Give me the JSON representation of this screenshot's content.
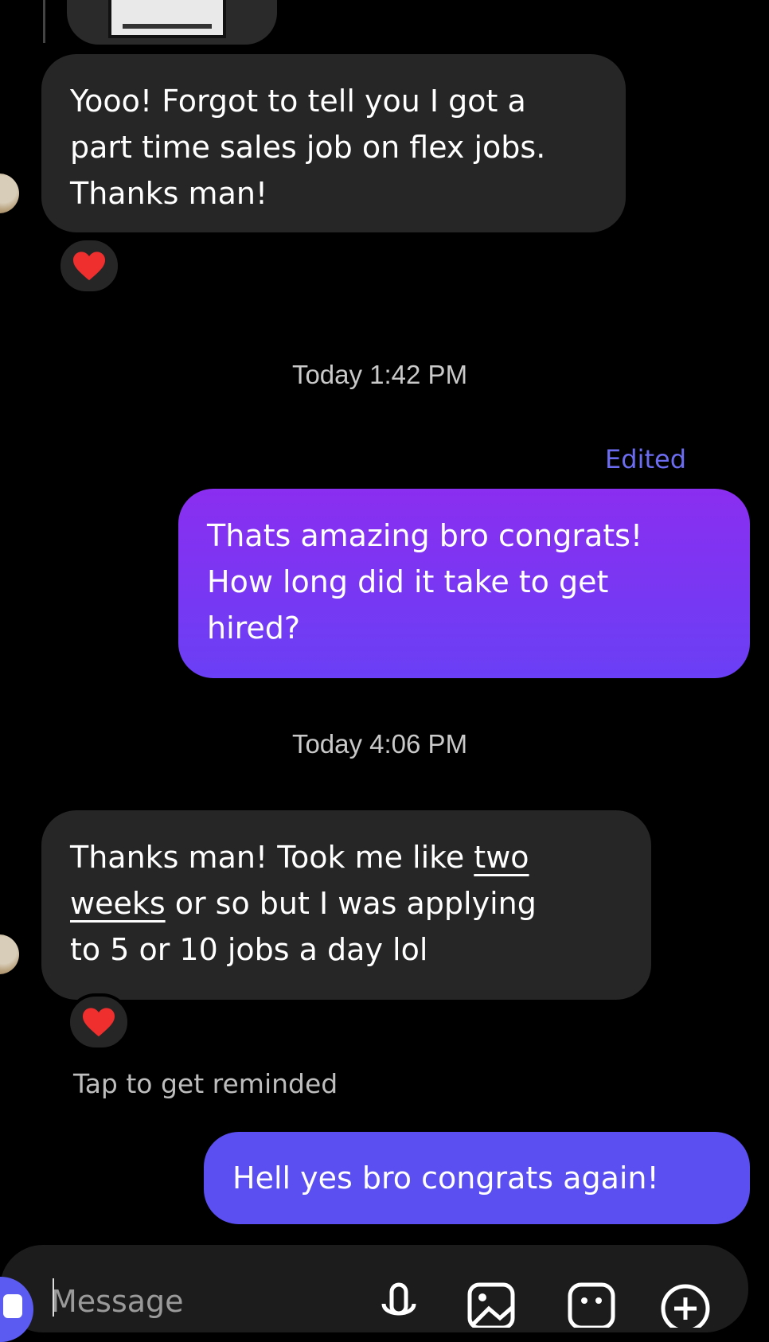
{
  "thread": {
    "messages": [
      {
        "direction": "incoming",
        "text": "Yooo! Forgot to tell you I got a part time sales job on flex jobs. Thanks man!",
        "lines": [
          "Yooo! Forgot to tell you I got a",
          "part time sales job on flex jobs.",
          "Thanks man!"
        ],
        "reaction": "❤️"
      },
      {
        "timestamp": "Today 1:42 PM"
      },
      {
        "direction": "outgoing",
        "status": "Edited",
        "text": "Thats amazing bro congrats! How long did it take to get hired?",
        "lines": [
          "Thats amazing bro congrats!",
          "How long did it take to get",
          "hired?"
        ]
      },
      {
        "timestamp": "Today 4:06 PM"
      },
      {
        "direction": "incoming",
        "text": "Thanks man! Took me like two weeks or so but I was applying to 5 or 10 jobs a day lol",
        "line1_plain": "Thanks man! Took me like ",
        "line1_link": "two",
        "line2_link": "weeks",
        "line2_plain": " or so but I was applying",
        "line3": "to 5 or 10 jobs a day lol",
        "reaction": "❤️",
        "action": "Tap to get reminded"
      },
      {
        "direction": "outgoing",
        "text": "Hell yes bro congrats again!"
      }
    ]
  },
  "composer": {
    "placeholder": "Message",
    "icons": [
      "compose-icon",
      "microphone-icon",
      "image-icon",
      "sticker-icon",
      "add-icon"
    ]
  },
  "colors": {
    "background": "#000000",
    "incoming_bubble": "#262626",
    "outgoing_gradient_top": "#8a2ef0",
    "outgoing_gradient_bottom": "#6a3ff5",
    "outgoing_solid": "#5b4ff2",
    "accent": "#6c6cf0"
  }
}
